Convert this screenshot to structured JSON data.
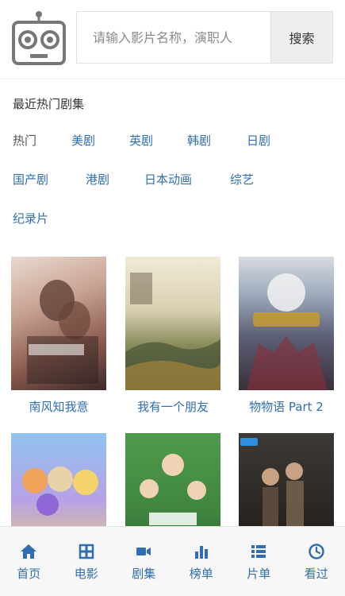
{
  "search": {
    "placeholder": "请输入影片名称，演职人",
    "button_label": "搜索"
  },
  "section": {
    "title": "最近热门剧集",
    "tags": [
      "热门",
      "美剧",
      "英剧",
      "韩剧",
      "日剧",
      "国产剧",
      "港剧",
      "日本动画",
      "综艺",
      "纪录片"
    ]
  },
  "posters": [
    {
      "title": "南风知我意",
      "badge": ""
    },
    {
      "title": "我有一个朋友",
      "badge": ""
    },
    {
      "title": "物物语 Part 2",
      "badge": ""
    },
    {
      "title": "",
      "badge": ""
    },
    {
      "title": "",
      "badge": ""
    },
    {
      "title": "",
      "badge": ""
    }
  ],
  "nav": {
    "items": [
      {
        "label": "首页",
        "icon": "home-icon"
      },
      {
        "label": "电影",
        "icon": "film-icon"
      },
      {
        "label": "剧集",
        "icon": "video-camera-icon"
      },
      {
        "label": "榜单",
        "icon": "bar-chart-icon"
      },
      {
        "label": "片单",
        "icon": "list-icon"
      },
      {
        "label": "看过",
        "icon": "clock-icon"
      }
    ]
  },
  "colors": {
    "accent": "#2f6fb1",
    "nav_bg": "#f7f7f7"
  }
}
